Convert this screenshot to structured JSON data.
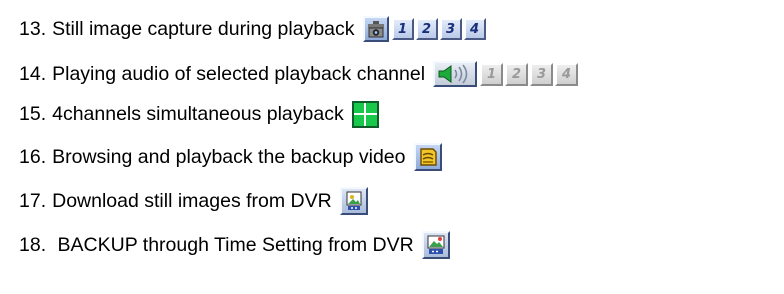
{
  "items": [
    {
      "number": "13.",
      "text": "Still image capture during playback",
      "icon": "camera-capture-icon",
      "channels": [
        "1",
        "2",
        "3",
        "4"
      ]
    },
    {
      "number": "14.",
      "text": "Playing audio of selected playback channel",
      "icon": "speaker-audio-icon",
      "channels": [
        "1",
        "2",
        "3",
        "4"
      ]
    },
    {
      "number": "15.",
      "text": "4channels simultaneous playback",
      "icon": "quad-split-icon"
    },
    {
      "number": "16.",
      "text": "Browsing and playback the backup video",
      "icon": "backup-video-icon"
    },
    {
      "number": "17.",
      "text": "Download still images from DVR",
      "icon": "download-image-icon"
    },
    {
      "number": "18.",
      "text": " BACKUP through Time Setting from DVR",
      "icon": "time-backup-icon"
    }
  ],
  "colors": {
    "icon_blue": "#9fb6e3",
    "channel_text": "#1a2f7a",
    "grid_green": "#18c84a",
    "folder_yellow": "#f2c629"
  }
}
